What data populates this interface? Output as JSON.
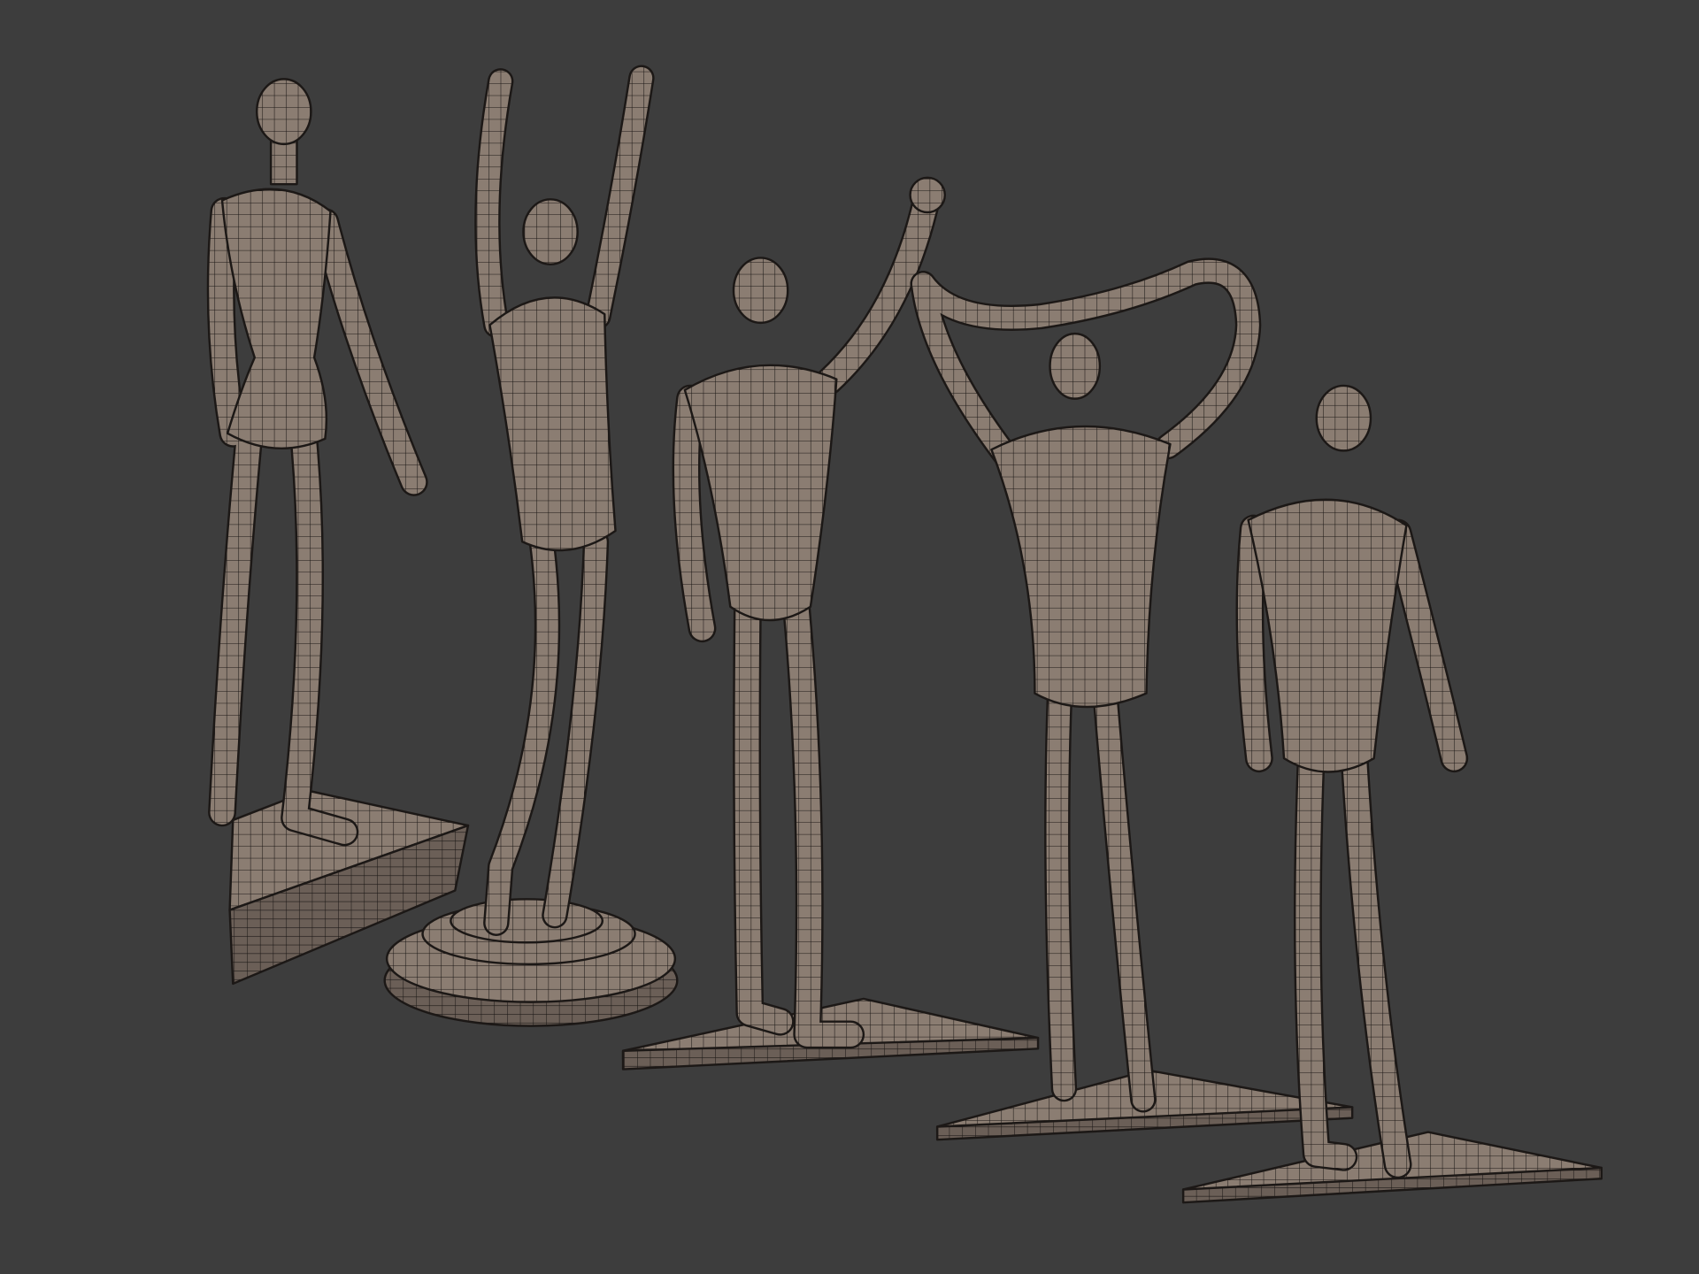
{
  "scene": {
    "background": "#3d3d3d",
    "mesh_color": "#8b7d72",
    "mesh_shade": "#6e625a",
    "wire_color": "#1c1816"
  }
}
